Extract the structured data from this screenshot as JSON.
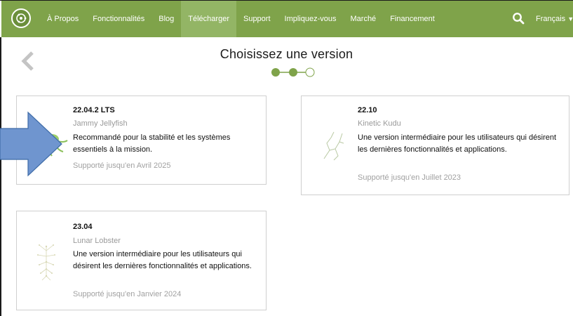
{
  "nav": {
    "items": [
      {
        "label": "À Propos",
        "active": false
      },
      {
        "label": "Fonctionnalités",
        "active": false
      },
      {
        "label": "Blog",
        "active": false
      },
      {
        "label": "Télécharger",
        "active": true
      },
      {
        "label": "Support",
        "active": false
      },
      {
        "label": "Impliquez-vous",
        "active": false
      },
      {
        "label": "Marché",
        "active": false
      },
      {
        "label": "Financement",
        "active": false
      }
    ],
    "language": "Français"
  },
  "header": {
    "title": "Choisissez une version",
    "steps_total": 3,
    "steps_completed": 2
  },
  "versions": [
    {
      "version": "22.04.2 LTS",
      "codename": "Jammy Jellyfish",
      "description": "Recommandé pour la stabilité et les systèmes essentiels à la mission.",
      "support": "Supporté jusqu'en Avril 2025",
      "mascot": "jellyfish-icon"
    },
    {
      "version": "22.10",
      "codename": "Kinetic Kudu",
      "description": "Une version intermédiaire pour les utilisateurs qui désirent les dernières fonctionnalités et applications.",
      "support": "Supporté jusqu'en Juillet 2023",
      "mascot": "kudu-icon"
    },
    {
      "version": "23.04",
      "codename": "Lunar Lobster",
      "description": "Une version intermédiaire pour les utilisateurs qui désirent les dernières fonctionnalités et applications.",
      "support": "Supporté jusqu'en Janvier 2024",
      "mascot": "lobster-icon"
    }
  ],
  "colors": {
    "brand_green": "#7fa34a",
    "active_tab": "#93b565",
    "step_dot": "#7fa34a",
    "arrow_blue": "#6f95cf"
  }
}
